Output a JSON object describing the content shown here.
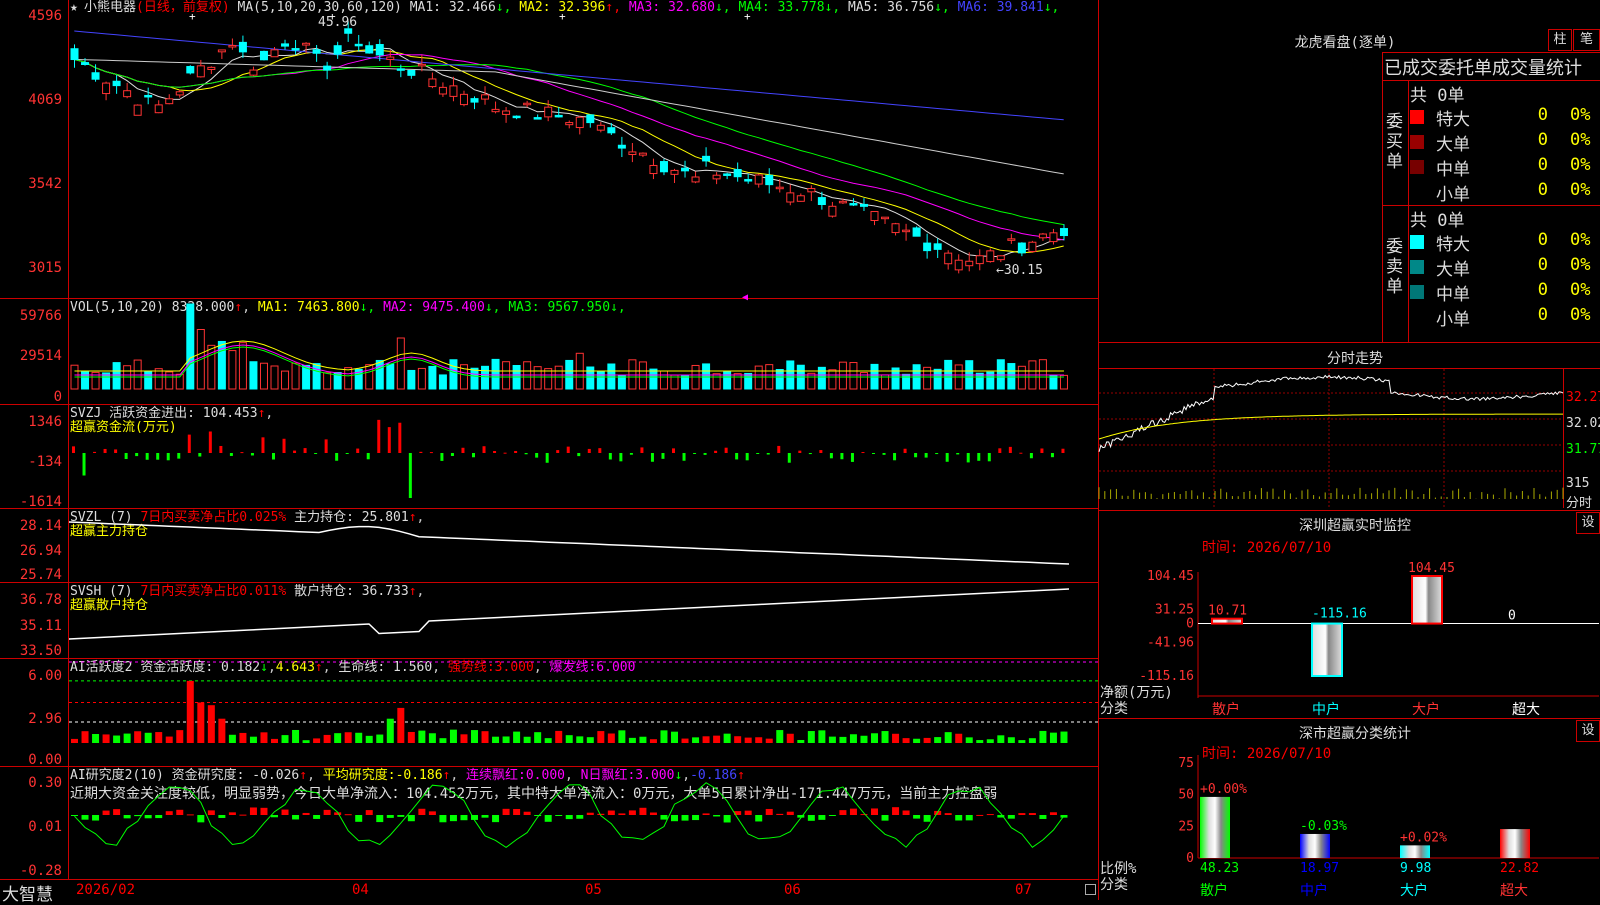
{
  "stock": {
    "name": "小熊电器",
    "mode": "(日线，前复权)"
  },
  "footer": {
    "brand": "大智慧",
    "dates": [
      "2026/02",
      "04",
      "05",
      "06",
      "07"
    ]
  },
  "price_panel": {
    "ma_label": "MA(5,10,20,30,60,120)",
    "ma": [
      {
        "name": "MA1:",
        "value": "32.466",
        "dir": "↓",
        "color": "#ddd"
      },
      {
        "name": "MA2:",
        "value": "32.396",
        "dir": "↑",
        "color": "#ff0"
      },
      {
        "name": "MA3:",
        "value": "32.680",
        "dir": "↓",
        "color": "#f0f"
      },
      {
        "name": "MA4:",
        "value": "33.778",
        "dir": "↓",
        "color": "#0f0"
      },
      {
        "name": "MA5:",
        "value": "36.756",
        "dir": "↓",
        "color": "#ddd"
      },
      {
        "name": "MA6:",
        "value": "39.841",
        "dir": "↓",
        "color": "#44f"
      }
    ],
    "y_labels": [
      "4596",
      "4069",
      "3542",
      "3015"
    ],
    "high_mark": "45.96",
    "low_mark": "←30.15"
  },
  "vol_panel": {
    "label": "VOL(5,10,20)",
    "value": "8328.000",
    "ma": [
      {
        "name": "MA1:",
        "value": "7463.800",
        "dir": "↓",
        "color": "#ff0"
      },
      {
        "name": "MA2:",
        "value": "9475.400",
        "dir": "↓",
        "color": "#f0f"
      },
      {
        "name": "MA3:",
        "value": "9567.950",
        "dir": "↓",
        "color": "#0f0"
      }
    ],
    "y_labels": [
      "59766",
      "29514",
      "0"
    ]
  },
  "svzj": {
    "label": "SVZJ",
    "text": "活跃资金进出:",
    "value": "104.453",
    "sub": "超赢资金流(万元)",
    "y_labels": [
      "1346",
      "-134",
      "-1614"
    ]
  },
  "svzl": {
    "label": "SVZL (7)",
    "ratio": "7日内买卖净占比0.025%",
    "hold_label": "主力持仓:",
    "hold": "25.801",
    "sub": "超赢主力持仓",
    "y_labels": [
      "28.14",
      "26.94",
      "25.74"
    ]
  },
  "svsh": {
    "label": "SVSH (7)",
    "ratio": "7日内买卖净占比0.011%",
    "hold_label": "散户持仓:",
    "hold": "36.733",
    "sub": "超赢散户持仓",
    "y_labels": [
      "36.78",
      "35.11",
      "33.50"
    ]
  },
  "ai_active": {
    "label": "AI活跃度2",
    "a_label": "资金活跃度:",
    "a": "0.182",
    "b": "4.643",
    "c_label": "生命线:",
    "c": "1.560",
    "d_label": "强势线:",
    "d": "3.000",
    "e_label": "爆发线:",
    "e": "6.000",
    "y_labels": [
      "6.00",
      "2.96",
      "0.00"
    ]
  },
  "ai_research": {
    "label": "AI研究度2(10)",
    "a_label": "资金研究度:",
    "a": "-0.026",
    "b_label": "平均研究度:",
    "b": "-0.186",
    "c_label": "连续飘红:",
    "c": "0.000",
    "d_label": "N日飘红:",
    "d": "3.000",
    "e": "-0.186",
    "comment": "近期大资金关注度较低，明显弱势，今日大单净流入：104.452万元，其中特大单净流入：0万元，大单5日累计净出-171.447万元，当前主力控盘弱",
    "y_labels": [
      "0.30",
      "0.01",
      "-0.28"
    ]
  },
  "right": {
    "lhb_title": "龙虎看盘(逐单)",
    "btn_zhu": "柱",
    "btn_bi": "笔",
    "tabs": "已成交委托单成交量统计",
    "buy_group": "委买单",
    "sell_group": "委卖单",
    "buy_total": "共 0单",
    "sell_total": "共 0单",
    "buy_rows": [
      {
        "label": "特大",
        "count": "0",
        "pct": "0%",
        "color": "#f00"
      },
      {
        "label": "大单",
        "count": "0",
        "pct": "0%",
        "color": "#900"
      },
      {
        "label": "中单",
        "count": "0",
        "pct": "0%",
        "color": "#700"
      },
      {
        "label": "小单",
        "count": "0",
        "pct": "0%",
        "color": ""
      }
    ],
    "sell_rows": [
      {
        "label": "特大",
        "count": "0",
        "pct": "0%",
        "color": "#0ff"
      },
      {
        "label": "大单",
        "count": "0",
        "pct": "0%",
        "color": "#088"
      },
      {
        "label": "中单",
        "count": "0",
        "pct": "0%",
        "color": "#077"
      },
      {
        "label": "小单",
        "count": "0",
        "pct": "0%",
        "color": ""
      }
    ],
    "timeline_title": "分时走势",
    "timeline_y": [
      "32.27",
      "32.02",
      "31.77",
      "315",
      "分时"
    ],
    "sz_title": "深圳超赢实时监控",
    "set1": "设",
    "sz_time": "时间: 2026/07/10",
    "sz_y": [
      "104.45",
      "31.25",
      "0",
      "-41.96",
      "-115.16"
    ],
    "sz_axis_title": "净额(万元)",
    "sz_axis_sub": "分类",
    "sz_bars": [
      {
        "name": "散户",
        "value": "10.71",
        "color": "#f00"
      },
      {
        "name": "中户",
        "value": "-115.16",
        "color": "#0ff"
      },
      {
        "name": "大户",
        "value": "104.45",
        "color": "#f00"
      },
      {
        "name": "超大",
        "value": "0",
        "color": "#ddd"
      }
    ],
    "ss_title": "深市超赢分类统计",
    "set2": "设",
    "ss_time": "时间: 2026/07/10",
    "ss_y": [
      "75",
      "50",
      "25",
      "0"
    ],
    "ss_axis_title": "比例%",
    "ss_axis_sub": "分类",
    "ss_bars": [
      {
        "name": "散户",
        "value": "48.23",
        "delta": "+0.00%"
      },
      {
        "name": "中户",
        "value": "18.97",
        "delta": "-0.03%"
      },
      {
        "name": "大户",
        "value": "9.98",
        "delta": "+0.02%"
      },
      {
        "name": "超大",
        "value": "22.82",
        "delta": ""
      }
    ]
  }
}
